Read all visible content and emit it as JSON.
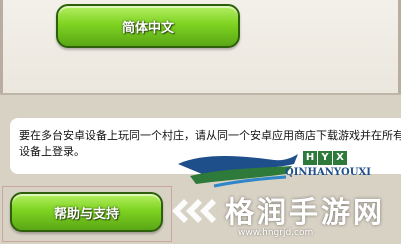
{
  "top_panel": {
    "language_button_label": "简体中文"
  },
  "message": {
    "text": "要在多台安卓设备上玩同一个村庄，请从同一个安卓应用商店下载游戏并在所有设备上登录。"
  },
  "help_button": {
    "label": "帮助与支持"
  },
  "watermark": {
    "brand_badge": [
      "H",
      "Y",
      "X"
    ],
    "brand_name": "QINHANYOUXI",
    "site_name": "格润手游网",
    "site_url": "www.hngrjd.com"
  },
  "colors": {
    "button_green": "#7ed321",
    "button_border": "#2e5f0c",
    "background": "#d8d2c5",
    "brand_blue": "#1e4f8a",
    "brand_green": "#2e7a3a"
  },
  "icons": {
    "logo": "dragon-logo-icon",
    "watermark_icon": "grid-logo-icon"
  }
}
